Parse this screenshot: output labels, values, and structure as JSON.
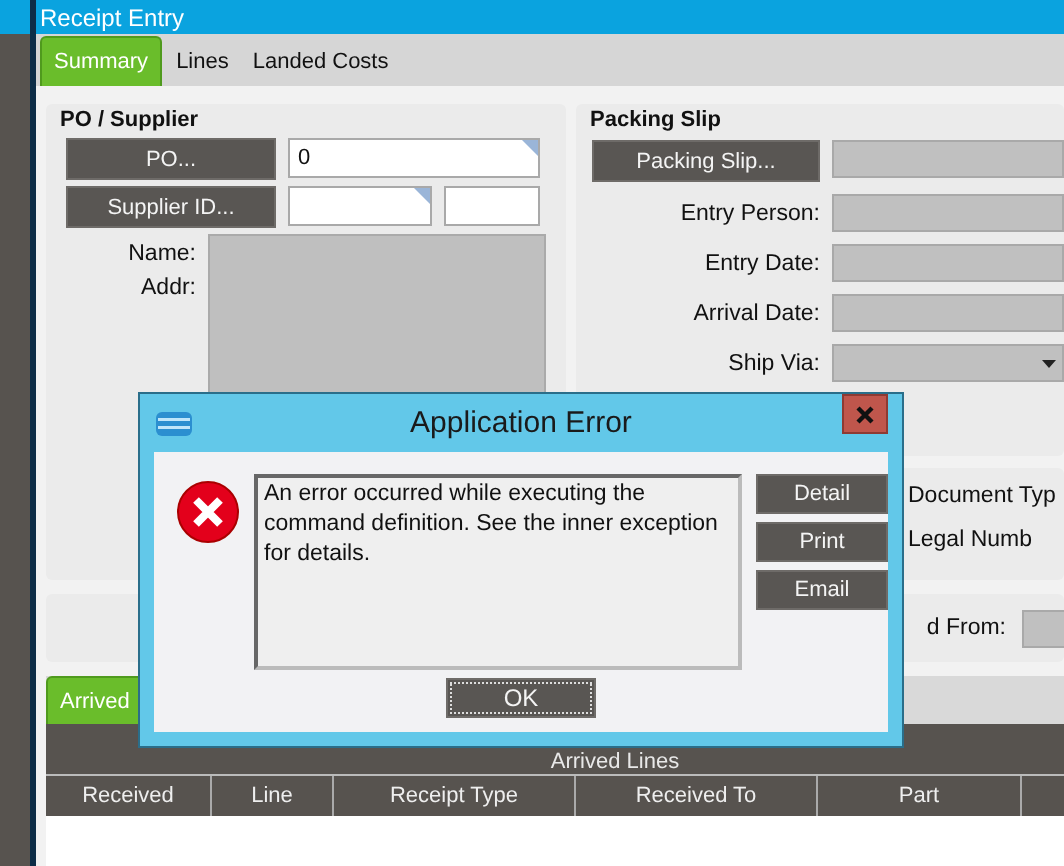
{
  "window": {
    "title": "Receipt Entry"
  },
  "tabs": [
    {
      "label": "Summary",
      "selected": true
    },
    {
      "label": "Lines",
      "selected": false
    },
    {
      "label": "Landed Costs",
      "selected": false
    }
  ],
  "po_supplier": {
    "title": "PO / Supplier",
    "po_button": "PO...",
    "po_value": "0",
    "supplier_button": "Supplier ID...",
    "name_label": "Name:",
    "addr_label": "Addr:"
  },
  "packing_slip": {
    "title": "Packing Slip",
    "button": "Packing Slip...",
    "fields": [
      {
        "label": "Entry Person:",
        "kind": "text"
      },
      {
        "label": "Entry Date:",
        "kind": "text"
      },
      {
        "label": "Arrival Date:",
        "kind": "text"
      },
      {
        "label": "Ship Via:",
        "kind": "dropdown"
      }
    ]
  },
  "document": {
    "labels": [
      "Document Typ",
      "Legal Numb"
    ]
  },
  "from_label": "d From:",
  "lines_tabs": [
    {
      "label": "Arrived",
      "selected": true
    }
  ],
  "grid": {
    "title": "Arrived Lines",
    "columns": [
      "Received",
      "Line",
      "Receipt Type",
      "Received To",
      "Part"
    ]
  },
  "dialog": {
    "title": "Application Error",
    "message": "An error occurred while executing the command definition. See the inner exception for details.",
    "side_buttons": [
      "Detail",
      "Print",
      "Email"
    ],
    "ok_button": "OK"
  }
}
